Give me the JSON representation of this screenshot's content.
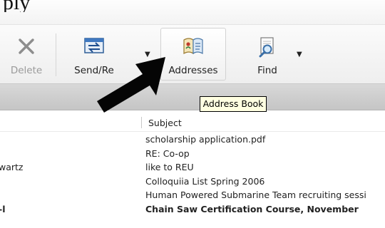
{
  "page_top_text": "ply",
  "toolbar": {
    "delete_label": "Delete",
    "send_receive_label": "Send/Re",
    "addresses_label": "Addresses",
    "find_label": "Find"
  },
  "tooltip": {
    "text": "Address Book"
  },
  "message_list": {
    "columns": {
      "subject": "Subject"
    },
    "rows": [
      {
        "from": "",
        "subject": "scholarship application.pdf",
        "unread": false
      },
      {
        "from": "",
        "subject": "RE: Co-op",
        "unread": false
      },
      {
        "from": "wartz",
        "subject": "like to REU",
        "unread": false
      },
      {
        "from": "",
        "subject": "Colloquiia List Spring 2006",
        "unread": false
      },
      {
        "from": "",
        "subject": "Human Powered Submarine Team recruiting sessi",
        "unread": false
      },
      {
        "from": "-l",
        "subject": "Chain Saw Certification Course, November",
        "unread": true
      }
    ]
  },
  "icons": {
    "delete": "delete-x-icon",
    "send_receive": "send-receive-icon",
    "addresses": "address-book-icon",
    "find": "find-magnifier-icon",
    "pointer": "black-arrow-pointer-icon"
  }
}
